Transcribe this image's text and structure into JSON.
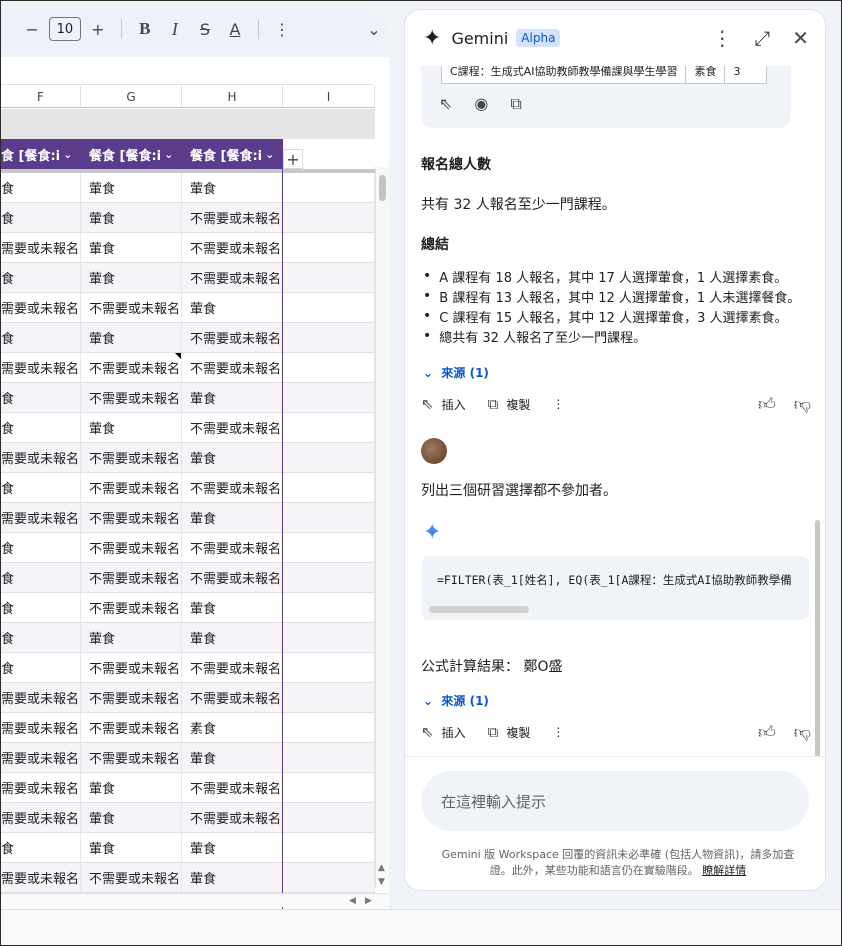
{
  "toolbar": {
    "minus": "−",
    "font_size": "10",
    "plus": "+",
    "bold": "B",
    "italic": "I",
    "strike": "S",
    "text_color": "A",
    "more": "⋮",
    "expand": "⌄"
  },
  "sheet": {
    "columns": [
      "F",
      "G",
      "H",
      "I"
    ],
    "headers": [
      "食 [餐食:i",
      "餐食 [餐食:i",
      "餐食 [餐食:i"
    ],
    "add_column": "+",
    "rows": [
      [
        "食",
        "葷食",
        "葷食"
      ],
      [
        "食",
        "葷食",
        "不需要或未報名"
      ],
      [
        "需要或未報名",
        "葷食",
        "不需要或未報名"
      ],
      [
        "食",
        "葷食",
        "不需要或未報名"
      ],
      [
        "需要或未報名",
        "不需要或未報名",
        "葷食"
      ],
      [
        "食",
        "葷食",
        "不需要或未報名"
      ],
      [
        "需要或未報名",
        "不需要或未報名",
        "不需要或未報名"
      ],
      [
        "食",
        "不需要或未報名",
        "葷食"
      ],
      [
        "食",
        "葷食",
        "不需要或未報名"
      ],
      [
        "需要或未報名",
        "不需要或未報名",
        "葷食"
      ],
      [
        "食",
        "不需要或未報名",
        "不需要或未報名"
      ],
      [
        "需要或未報名",
        "不需要或未報名",
        "葷食"
      ],
      [
        "食",
        "不需要或未報名",
        "不需要或未報名"
      ],
      [
        "食",
        "不需要或未報名",
        "不需要或未報名"
      ],
      [
        "食",
        "不需要或未報名",
        "葷食"
      ],
      [
        "食",
        "葷食",
        "葷食"
      ],
      [
        "食",
        "不需要或未報名",
        "不需要或未報名"
      ],
      [
        "需要或未報名",
        "不需要或未報名",
        "不需要或未報名"
      ],
      [
        "需要或未報名",
        "不需要或未報名",
        "素食"
      ],
      [
        "需要或未報名",
        "不需要或未報名",
        "葷食"
      ],
      [
        "需要或未報名",
        "葷食",
        "不需要或未報名"
      ],
      [
        "需要或未報名",
        "葷食",
        "不需要或未報名"
      ],
      [
        "食",
        "葷食",
        "葷食"
      ],
      [
        "需要或未報名",
        "不需要或未報名",
        "葷食"
      ]
    ]
  },
  "gemini": {
    "title": "Gemini",
    "badge": "Alpha",
    "mini_table": [
      "C課程：生成式AI協助教師教學備課與學生學習",
      "素食",
      "3"
    ],
    "total_heading": "報名總人數",
    "total_text": "共有 32 人報名至少一門課程。",
    "summary_heading": "總結",
    "summary_items": [
      "A 課程有 18 人報名，其中 17 人選擇葷食，1 人選擇素食。",
      "B 課程有 13 人報名，其中 12 人選擇葷食，1 人未選擇餐食。",
      "C 課程有 15 人報名，其中 12 人選擇葷食，3 人選擇素食。",
      "總共有 32 人報名了至少一門課程。"
    ],
    "sources_label": "來源 (1)",
    "insert_label": "插入",
    "copy_label": "複製",
    "user_prompt": "列出三個研習選擇都不參加者。",
    "formula": "=FILTER(表_1[姓名], EQ(表_1[A課程：生成式AI協助教師教學備",
    "result": "公式計算結果： 鄭O盛",
    "sources_label_2": "來源 (1)",
    "input_placeholder": "在這裡輸入提示",
    "disclaimer": "Gemini 版 Workspace 回覆的資訊未必準確 (包括人物資訊)，請多加查證。此外，某些功能和語言仍在實驗階段。",
    "learn_more": "瞭解詳情"
  },
  "colors": {
    "header_purple": "#5b3b8c",
    "link_blue": "#0b57d0",
    "panel_bg": "#ffffff"
  }
}
